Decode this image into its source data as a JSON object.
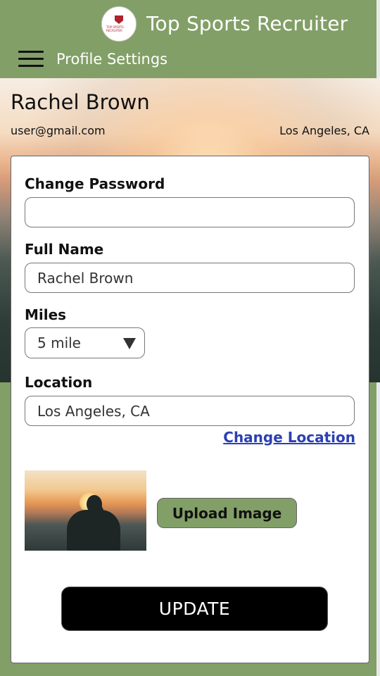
{
  "header": {
    "app_title": "Top Sports Recruiter",
    "page_title": "Profile Settings",
    "logo_text": "TOP SPORTS RECRUITER"
  },
  "profile": {
    "name": "Rachel Brown",
    "email": "user@gmail.com",
    "location": "Los Angeles, CA"
  },
  "form": {
    "password_label": "Change Password",
    "password_value": "",
    "fullname_label": "Full Name",
    "fullname_value": "Rachel Brown",
    "miles_label": "Miles",
    "miles_value": "5 mile",
    "location_label": "Location",
    "location_value": "Los Angeles, CA",
    "change_location_link": "Change Location",
    "upload_button": "Upload Image",
    "update_button": "UPDATE"
  },
  "colors": {
    "header_bg": "#829f67",
    "link": "#2b3fb4",
    "update_bg": "#000000"
  }
}
